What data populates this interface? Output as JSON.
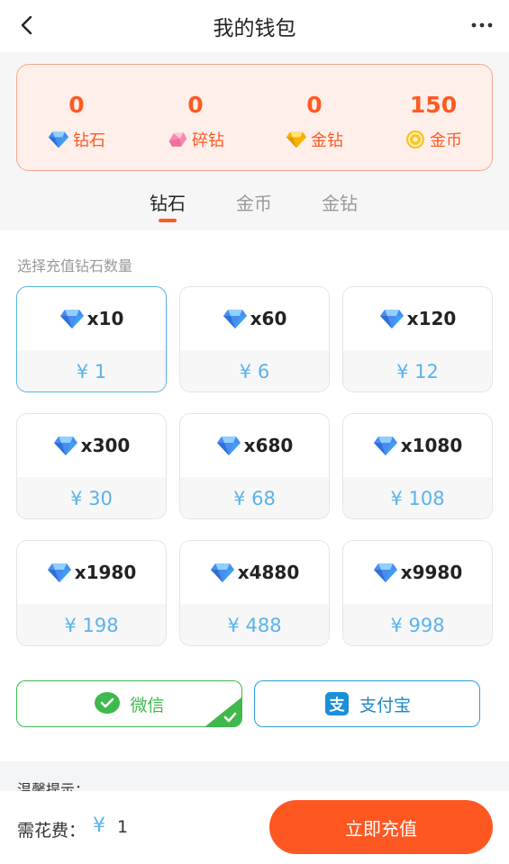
{
  "header": {
    "title": "我的钱包",
    "back_icon": "chevron-left-icon",
    "more_icon": "more-dots-icon"
  },
  "balance": [
    {
      "value": "0",
      "label": "钻石",
      "icon": "diamond-icon"
    },
    {
      "value": "0",
      "label": "碎钻",
      "icon": "pink-gem-icon"
    },
    {
      "value": "0",
      "label": "金钻",
      "icon": "gold-diamond-icon"
    },
    {
      "value": "150",
      "label": "金币",
      "icon": "gold-coin-icon"
    }
  ],
  "tabs": [
    {
      "label": "钻石",
      "active": true
    },
    {
      "label": "金币",
      "active": false
    },
    {
      "label": "金钻",
      "active": false
    }
  ],
  "section_label": "选择充值钻石数量",
  "packages": [
    {
      "qty": "x10",
      "price": "¥ 1",
      "selected": true
    },
    {
      "qty": "x60",
      "price": "¥ 6",
      "selected": false
    },
    {
      "qty": "x120",
      "price": "¥ 12",
      "selected": false
    },
    {
      "qty": "x300",
      "price": "¥ 30",
      "selected": false
    },
    {
      "qty": "x680",
      "price": "¥ 68",
      "selected": false
    },
    {
      "qty": "x1080",
      "price": "¥ 108",
      "selected": false
    },
    {
      "qty": "x1980",
      "price": "¥ 198",
      "selected": false
    },
    {
      "qty": "x4880",
      "price": "¥ 488",
      "selected": false
    },
    {
      "qty": "x9980",
      "price": "¥ 998",
      "selected": false
    }
  ],
  "payment": {
    "wechat": {
      "label": "微信",
      "icon": "wechat-pay-icon",
      "selected": true
    },
    "alipay": {
      "label": "支付宝",
      "icon": "alipay-icon",
      "selected": false
    }
  },
  "tips": {
    "title": "温馨提示："
  },
  "footer": {
    "cost_label": "需花费：",
    "currency": "¥",
    "cost_value": "1",
    "submit_label": "立即充值"
  },
  "colors": {
    "accent": "#ff5722",
    "price_blue": "#5ab3eb",
    "wechat_green": "#3fb94b",
    "alipay_blue": "#2a9fd8"
  }
}
